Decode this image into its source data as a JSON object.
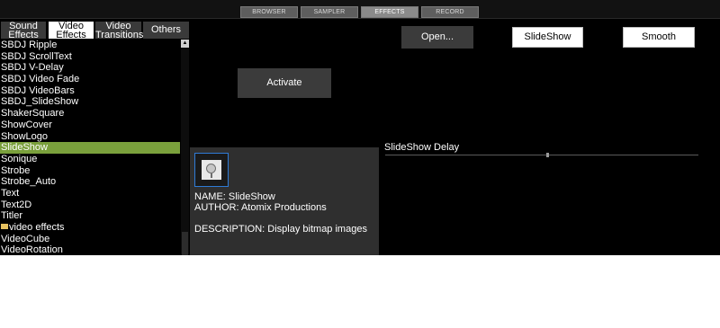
{
  "top_tabs": [
    {
      "label": "BROWSER"
    },
    {
      "label": "SAMPLER"
    },
    {
      "label": "EFFECTS",
      "active": true
    },
    {
      "label": "RECORD"
    }
  ],
  "category_tabs": {
    "sound_effects": [
      "Sound",
      "Effects"
    ],
    "video_effects": [
      "Video",
      "Effects"
    ],
    "video_transitions": [
      "Video",
      "Transitions"
    ],
    "others": "Others"
  },
  "effects_list": {
    "items": [
      {
        "label": "SBDJ Ripple"
      },
      {
        "label": "SBDJ ScrollText"
      },
      {
        "label": "SBDJ V-Delay"
      },
      {
        "label": "SBDJ Video Fade"
      },
      {
        "label": "SBDJ VideoBars"
      },
      {
        "label": "SBDJ_SlideShow"
      },
      {
        "label": "ShakerSquare"
      },
      {
        "label": "ShowCover"
      },
      {
        "label": "ShowLogo"
      },
      {
        "label": "SlideShow",
        "selected": true
      },
      {
        "label": "Sonique"
      },
      {
        "label": "Strobe"
      },
      {
        "label": "Strobe_Auto"
      },
      {
        "label": "Text"
      },
      {
        "label": "Text2D"
      },
      {
        "label": "Titler"
      },
      {
        "label": "video effects",
        "folder": true
      },
      {
        "label": "VideoCube"
      },
      {
        "label": "VideoRotation"
      }
    ]
  },
  "buttons": {
    "activate": "Activate",
    "open": "Open...",
    "slideshow": "SlideShow",
    "smooth": "Smooth"
  },
  "info": {
    "name": "NAME: SlideShow",
    "author": "AUTHOR: Atomix Productions",
    "description": "DESCRIPTION: Display bitmap images"
  },
  "parameter": {
    "label": "SlideShow Delay",
    "value_fraction": 0.52
  },
  "colors": {
    "selected_item": "#7aa03c",
    "thumb_border": "#2f7bd6",
    "folder_icon": "#e6c260"
  }
}
